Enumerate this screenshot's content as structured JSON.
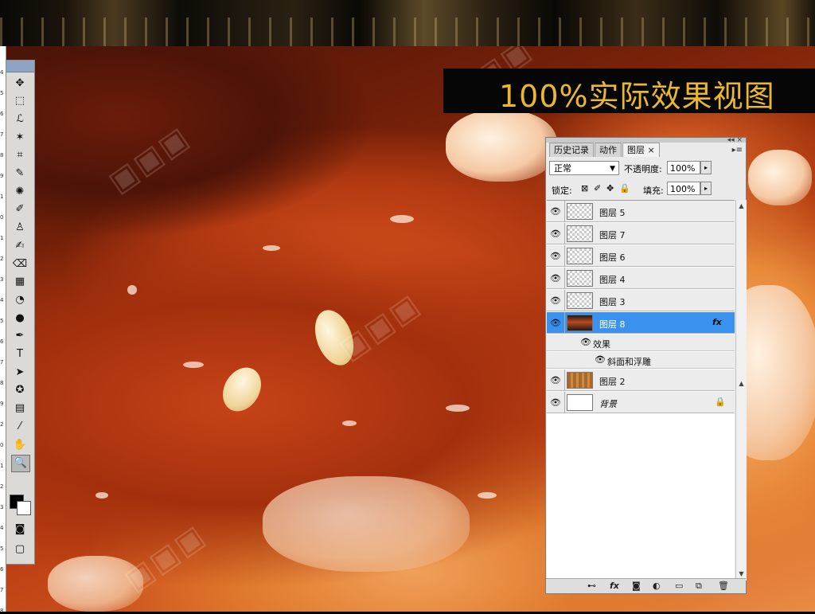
{
  "banner": {
    "title": "100%实际效果视图"
  },
  "background": {
    "watermark_present": true
  },
  "ruler": {
    "ticks": [
      "4",
      "5",
      "6",
      "7",
      "8",
      "9",
      "1",
      "0",
      "1",
      "2",
      "3",
      "4",
      "5",
      "6",
      "7",
      "8",
      "9",
      "2",
      "0",
      "1",
      "2",
      "3",
      "4",
      "5",
      "6",
      "7",
      "8"
    ]
  },
  "toolbox": {
    "tools": [
      {
        "name": "move-tool",
        "glyph": "✥"
      },
      {
        "name": "marquee-tool",
        "glyph": "⬚"
      },
      {
        "name": "lasso-tool",
        "glyph": "ℒ"
      },
      {
        "name": "magic-wand-tool",
        "glyph": "✶"
      },
      {
        "name": "crop-tool",
        "glyph": "⌗"
      },
      {
        "name": "slice-tool",
        "glyph": "✎"
      },
      {
        "name": "healing-brush-tool",
        "glyph": "✺"
      },
      {
        "name": "brush-tool",
        "glyph": "✐"
      },
      {
        "name": "stamp-tool",
        "glyph": "♙"
      },
      {
        "name": "history-brush-tool",
        "glyph": "✍"
      },
      {
        "name": "eraser-tool",
        "glyph": "⌫"
      },
      {
        "name": "gradient-tool",
        "glyph": "▦"
      },
      {
        "name": "blur-tool",
        "glyph": "◔"
      },
      {
        "name": "dodge-tool",
        "glyph": "●"
      },
      {
        "name": "pen-tool",
        "glyph": "✒"
      },
      {
        "name": "type-tool",
        "glyph": "T"
      },
      {
        "name": "path-selection-tool",
        "glyph": "➤"
      },
      {
        "name": "shape-tool",
        "glyph": "✪"
      },
      {
        "name": "notes-tool",
        "glyph": "▤"
      },
      {
        "name": "eyedropper-tool",
        "glyph": "⁄"
      },
      {
        "name": "hand-tool",
        "glyph": "✋"
      },
      {
        "name": "zoom-tool",
        "glyph": "🔍"
      }
    ],
    "active_tool": "zoom-tool",
    "foreground_color": "#000000",
    "background_color": "#ffffff"
  },
  "layers_panel": {
    "tabs": [
      {
        "label": "历史记录",
        "active": false
      },
      {
        "label": "动作",
        "active": false
      },
      {
        "label": "图层",
        "active": true
      }
    ],
    "close_glyph": "×",
    "blend_mode": "正常",
    "opacity_label": "不透明度:",
    "opacity_value": "100%",
    "lock_label": "锁定:",
    "fill_label": "填充:",
    "fill_value": "100%",
    "layers": [
      {
        "name": "图层 5",
        "thumb": "transparent",
        "selected": false
      },
      {
        "name": "图层 7",
        "thumb": "transparent",
        "selected": false
      },
      {
        "name": "图层 6",
        "thumb": "transparent",
        "selected": false
      },
      {
        "name": "图层 4",
        "thumb": "transparent",
        "selected": false
      },
      {
        "name": "图层 3",
        "thumb": "transparent",
        "selected": false
      },
      {
        "name": "图层 8",
        "thumb": "image",
        "selected": true,
        "fx": "fx"
      },
      {
        "name": "图层 2",
        "thumb": "wood",
        "selected": false
      },
      {
        "name": "背景",
        "thumb": "white",
        "selected": false,
        "locked": true
      }
    ],
    "effects_label": "效果",
    "effect_item": "斜面和浮雕",
    "accent_color": "#3a92ee"
  }
}
